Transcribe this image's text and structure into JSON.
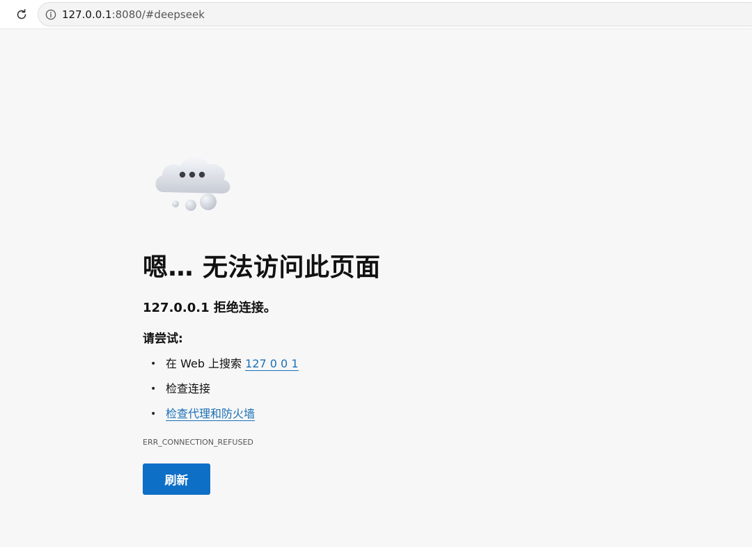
{
  "browser": {
    "url_host": "127.0.0.1",
    "url_rest": ":8080/#deepseek",
    "reload_icon": "reload-icon",
    "info_icon": "info-icon"
  },
  "error_page": {
    "illustration_icon": "cloud-with-dots-icon",
    "title": "嗯… 无法访问此页面",
    "subtitle": "127.0.0.1 拒绝连接。",
    "try_label": "请尝试:",
    "suggestions": [
      {
        "prefix": "在 Web 上搜索 ",
        "link": "127 0 0 1"
      },
      {
        "text": "检查连接"
      },
      {
        "link": "检查代理和防火墙"
      }
    ],
    "bullet": "•",
    "error_code": "ERR_CONNECTION_REFUSED",
    "refresh_label": "刷新"
  },
  "colors": {
    "accent": "#0e6fc7",
    "link": "#1a6fb5",
    "background": "#f7f7f7"
  }
}
